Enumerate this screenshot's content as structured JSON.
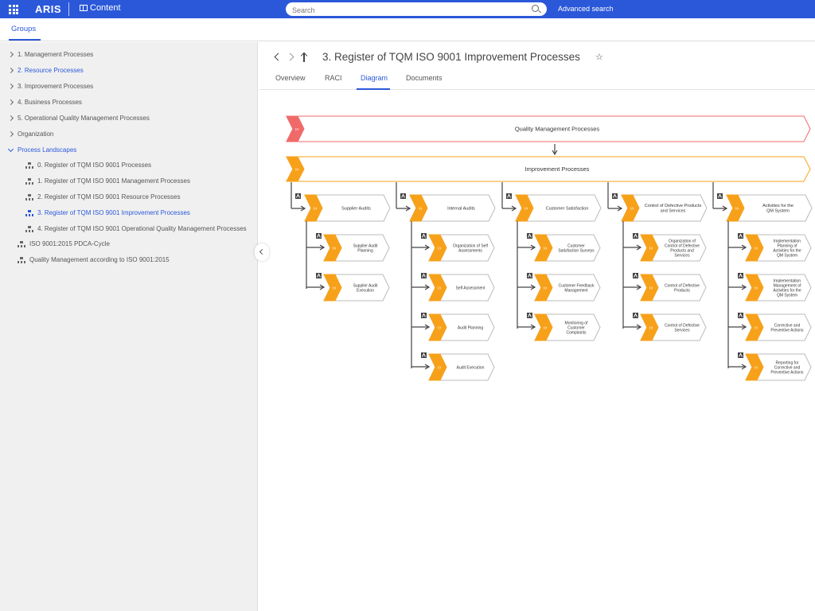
{
  "topbar": {
    "logo": "ARIS",
    "content_label": "Content",
    "search_placeholder": "Search",
    "advanced_search": "Advanced search"
  },
  "subbar": {
    "groups_tab": "Groups"
  },
  "sidebar": {
    "items": [
      {
        "label": "1. Management Processes"
      },
      {
        "label": "2. Resource Processes"
      },
      {
        "label": "3. Improvement Processes"
      },
      {
        "label": "4. Business Processes"
      },
      {
        "label": "5. Operational Quality Management Processes"
      },
      {
        "label": "Organization"
      },
      {
        "label": "Process Landscapes"
      },
      {
        "label": "0. Register of TQM ISO 9001 Processes"
      },
      {
        "label": "1. Register of TQM ISO 9001 Management Processes"
      },
      {
        "label": "2. Register of TQM ISO 9001 Resource Processes"
      },
      {
        "label": "3. Register of TQM ISO 9001 Improvement Processes"
      },
      {
        "label": "4. Register of TQM ISO 9001 Operational Quality Management Processes"
      },
      {
        "label": "ISO 9001:2015 PDCA-Cycle"
      },
      {
        "label": "Quality Management according to ISO 9001:2015"
      }
    ]
  },
  "main": {
    "title": "3. Register of TQM ISO 9001 Improvement Processes",
    "tabs": [
      "Overview",
      "RACI",
      "Diagram",
      "Documents"
    ]
  },
  "diagram": {
    "top": "Quality Management Processes",
    "second": "Improvement Processes",
    "columns": [
      {
        "label": [
          "Supplier Audits"
        ],
        "children": [
          [
            "Supplier Audit",
            "Planning"
          ],
          [
            "Supplier Audit",
            "Execution"
          ]
        ]
      },
      {
        "label": [
          "Internal Audits"
        ],
        "children": [
          [
            "Organization of Self",
            "Assessments"
          ],
          [
            "Self Assessment"
          ],
          [
            "Audit Planning"
          ],
          [
            "Audit Execution"
          ]
        ]
      },
      {
        "label": [
          "Customer Satisfaction"
        ],
        "children": [
          [
            "Customer",
            "Satisfaction Surveys"
          ],
          [
            "Customer Feedback",
            "Management"
          ],
          [
            "Monitoring of",
            "Customer",
            "Complaints"
          ]
        ]
      },
      {
        "label": [
          "Control of Defective Products",
          "and Services"
        ],
        "children": [
          [
            "Organization of",
            "Control of Defective",
            "Products and",
            "Services"
          ],
          [
            "Control of Defective",
            "Products"
          ],
          [
            "Control of Defective",
            "Services"
          ]
        ]
      },
      {
        "label": [
          "Activities for the",
          "QM System"
        ],
        "children": [
          [
            "Implementation",
            "Planning of",
            "Activities for the",
            "QM System"
          ],
          [
            "Implementation",
            "Management of",
            "Activities for the",
            "QM System"
          ],
          [
            "Corrective and",
            "Preventive Actions"
          ],
          [
            "Reporting for",
            "Corrective and",
            "Preventive Actions"
          ]
        ]
      }
    ],
    "colors": {
      "accent": "#f7a11a",
      "top_accent": "#f06a6a",
      "top_border": "#f06a6a"
    }
  }
}
